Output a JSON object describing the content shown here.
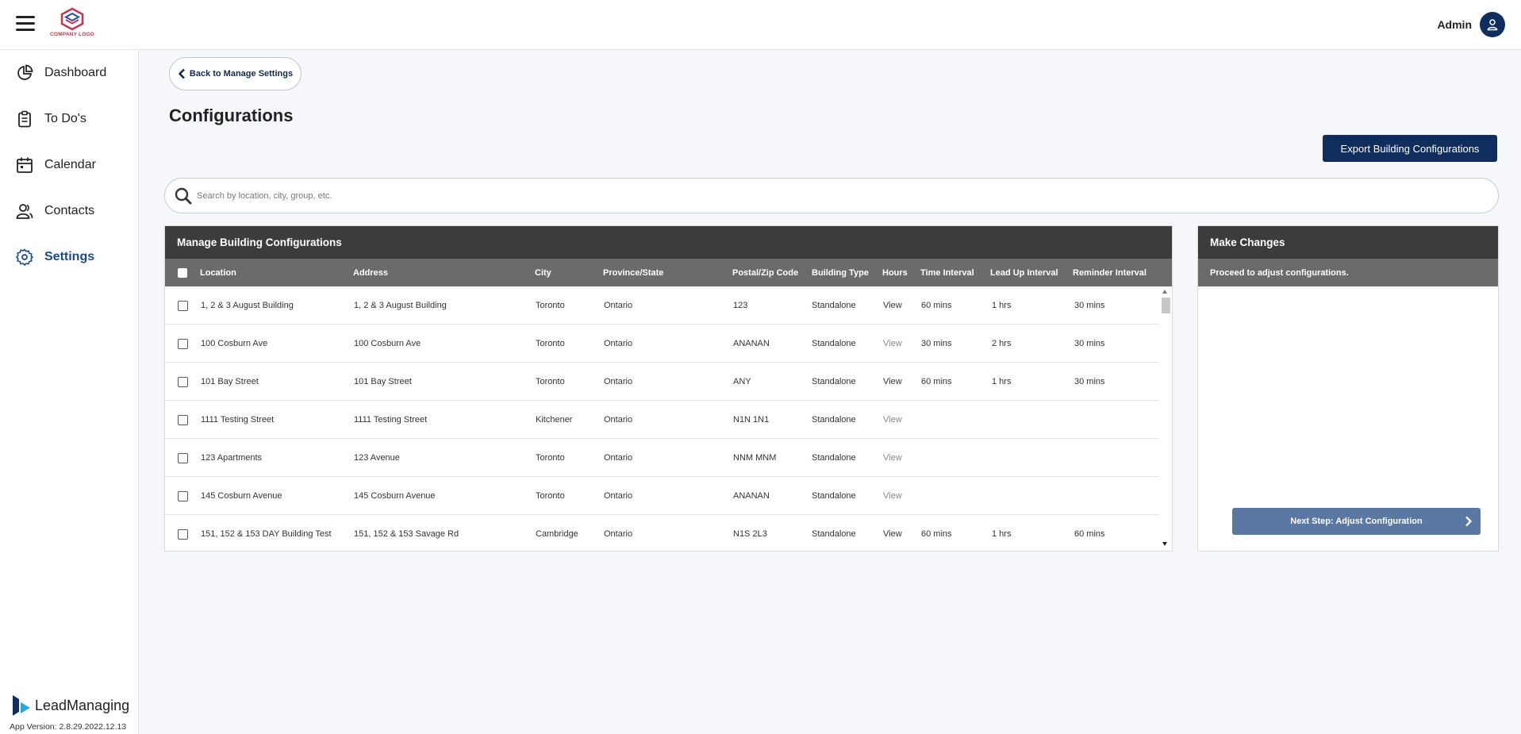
{
  "header": {
    "logo_text": "COMPANY LOGO",
    "user_name": "Admin"
  },
  "sidebar": {
    "items": [
      {
        "label": "Dashboard",
        "icon": "pie-chart-icon"
      },
      {
        "label": "To Do's",
        "icon": "clipboard-icon"
      },
      {
        "label": "Calendar",
        "icon": "calendar-icon"
      },
      {
        "label": "Contacts",
        "icon": "contacts-icon"
      },
      {
        "label": "Settings",
        "icon": "gear-icon",
        "active": true
      }
    ],
    "brand": "LeadManaging",
    "app_version": "App Version: 2.8.29.2022.12.13"
  },
  "main": {
    "back_label": "Back to Manage Settings",
    "title": "Configurations",
    "export_label": "Export Building Configurations",
    "search_placeholder": "Search by location, city, group, etc."
  },
  "table": {
    "title": "Manage Building Configurations",
    "columns": [
      "Location",
      "Address",
      "City",
      "Province/State",
      "Postal/Zip Code",
      "Building Type",
      "Hours",
      "Time Interval",
      "Lead Up Interval",
      "Reminder Interval"
    ],
    "rows": [
      [
        "1, 2 & 3 August Building",
        "1, 2 & 3 August Building",
        "Toronto",
        "Ontario",
        "123",
        "Standalone",
        "View",
        "60 mins",
        "1 hrs",
        "30 mins"
      ],
      [
        "100 Cosburn Ave",
        "100 Cosburn Ave",
        "Toronto",
        "Ontario",
        "ANANAN",
        "Standalone",
        "View",
        "30 mins",
        "2 hrs",
        "30 mins"
      ],
      [
        "101 Bay Street",
        "101 Bay Street",
        "Toronto",
        "Ontario",
        "ANY",
        "Standalone",
        "View",
        "60 mins",
        "1 hrs",
        "30 mins"
      ],
      [
        "1111 Testing Street",
        "1111 Testing Street",
        "Kitchener",
        "Ontario",
        "N1N 1N1",
        "Standalone",
        "View",
        "",
        "",
        ""
      ],
      [
        "123 Apartments",
        "123 Avenue",
        "Toronto",
        "Ontario",
        "NNM MNM",
        "Standalone",
        "View",
        "",
        "",
        ""
      ],
      [
        "145 Cosburn Avenue",
        "145 Cosburn Avenue",
        "Toronto",
        "Ontario",
        "ANANAN",
        "Standalone",
        "View",
        "",
        "",
        ""
      ],
      [
        "151, 152 & 153 DAY Building Test",
        "151, 152 & 153 Savage Rd",
        "Cambridge",
        "Ontario",
        "N1S 2L3",
        "Standalone",
        "View",
        "60 mins",
        "1 hrs",
        "60 mins"
      ]
    ]
  },
  "side_panel": {
    "title": "Make Changes",
    "subtitle": "Proceed to adjust configurations.",
    "next_label": "Next Step: Adjust Configuration"
  },
  "colors": {
    "primary": "#0f2e5e",
    "active_nav": "#1a4b8c",
    "panel_header": "#3c3c3c",
    "column_header": "#6b6b6b",
    "next_button": "#5a78a1",
    "logo_accent": "#c8334e"
  }
}
